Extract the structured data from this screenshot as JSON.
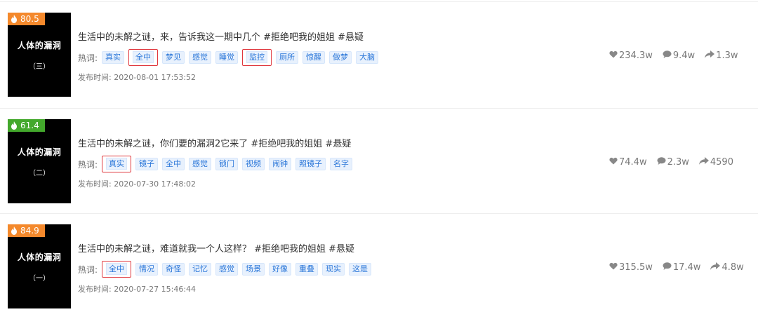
{
  "colors": {
    "accent_orange": "#f4892c",
    "accent_green": "#43a82c",
    "tag_blue": "#2b77d9",
    "highlight_red": "#e0383e"
  },
  "hot_label": "热词:",
  "time_prefix": "发布时间:",
  "items": [
    {
      "score": "80.5",
      "score_color": "#f4892c",
      "thumb_title": "人体的漏洞",
      "thumb_sub": "（三）",
      "headline": "生活中的未解之谜，来，告诉我这一期中几个 #拒绝吧我的姐姐 #悬疑",
      "tags": [
        {
          "text": "真实",
          "highlighted": false
        },
        {
          "text": "全中",
          "highlighted": true
        },
        {
          "text": "梦见",
          "highlighted": false
        },
        {
          "text": "感觉",
          "highlighted": false
        },
        {
          "text": "睡觉",
          "highlighted": false
        },
        {
          "text": "监控",
          "highlighted": true
        },
        {
          "text": "厕所",
          "highlighted": false
        },
        {
          "text": "惊醒",
          "highlighted": false
        },
        {
          "text": "做梦",
          "highlighted": false
        },
        {
          "text": "大脑",
          "highlighted": false
        }
      ],
      "time": "2020-08-01 17:53:52",
      "likes": "234.3w",
      "comments": "9.4w",
      "shares": "1.3w"
    },
    {
      "score": "61.4",
      "score_color": "#43a82c",
      "thumb_title": "人体的漏洞",
      "thumb_sub": "（二）",
      "headline": "生活中的未解之谜，你们要的漏洞2它来了 #拒绝吧我的姐姐 #悬疑",
      "tags": [
        {
          "text": "真实",
          "highlighted": true
        },
        {
          "text": "镜子",
          "highlighted": false
        },
        {
          "text": "全中",
          "highlighted": false
        },
        {
          "text": "感觉",
          "highlighted": false
        },
        {
          "text": "锁门",
          "highlighted": false
        },
        {
          "text": "视频",
          "highlighted": false
        },
        {
          "text": "闹钟",
          "highlighted": false
        },
        {
          "text": "照镜子",
          "highlighted": false
        },
        {
          "text": "名字",
          "highlighted": false
        }
      ],
      "time": "2020-07-30 17:48:02",
      "likes": "74.4w",
      "comments": "2.3w",
      "shares": "4590"
    },
    {
      "score": "84.9",
      "score_color": "#f4892c",
      "thumb_title": "人体的漏洞",
      "thumb_sub": "（一）",
      "headline": "生活中的未解之谜，难道就我一个人这样？ #拒绝吧我的姐姐 #悬疑",
      "tags": [
        {
          "text": "全中",
          "highlighted": true
        },
        {
          "text": "情况",
          "highlighted": false
        },
        {
          "text": "奇怪",
          "highlighted": false
        },
        {
          "text": "记忆",
          "highlighted": false
        },
        {
          "text": "感觉",
          "highlighted": false
        },
        {
          "text": "场景",
          "highlighted": false
        },
        {
          "text": "好像",
          "highlighted": false
        },
        {
          "text": "重叠",
          "highlighted": false
        },
        {
          "text": "现实",
          "highlighted": false
        },
        {
          "text": "这是",
          "highlighted": false
        }
      ],
      "time": "2020-07-27 15:46:44",
      "likes": "315.5w",
      "comments": "17.4w",
      "shares": "4.8w"
    }
  ]
}
